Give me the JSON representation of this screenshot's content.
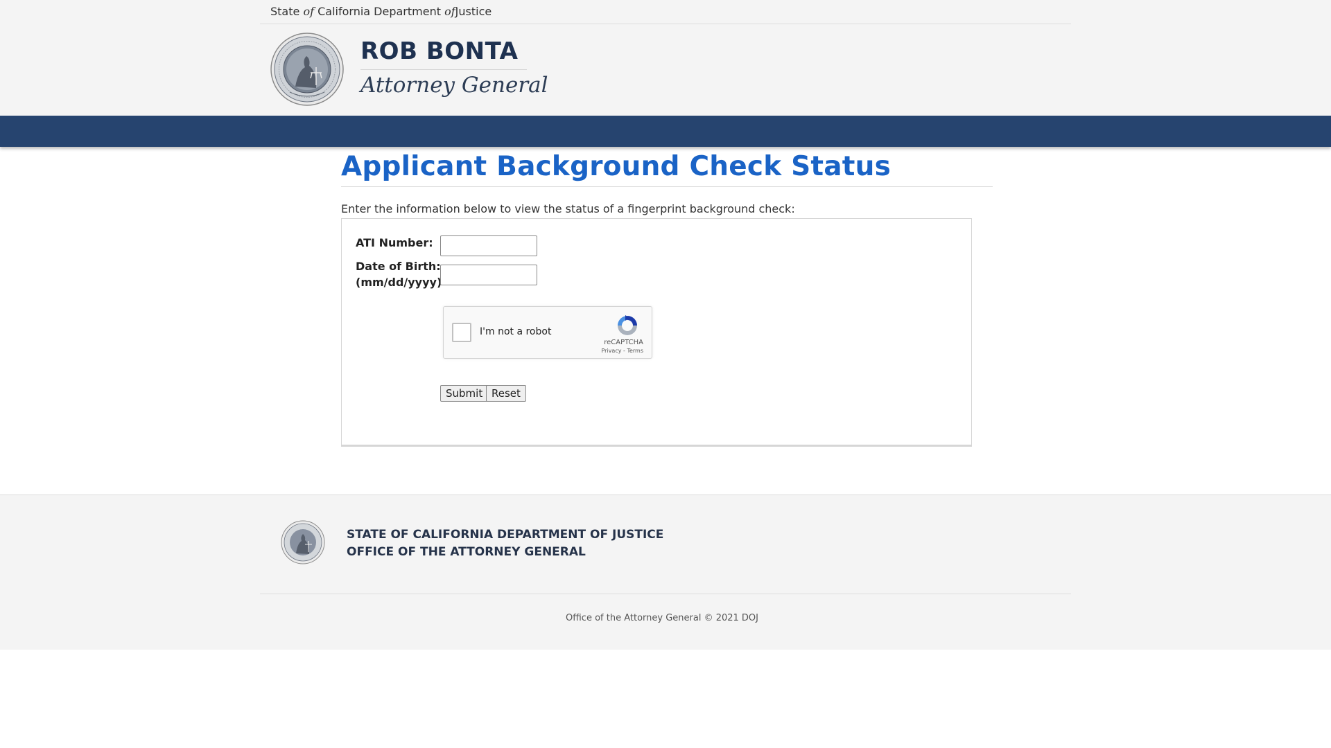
{
  "header": {
    "agency_prefix": "State",
    "agency_of1": "of",
    "agency_middle": "California Department",
    "agency_of2": "of",
    "agency_suffix": "Justice",
    "name": "ROB BONTA",
    "title": "Attorney General"
  },
  "main": {
    "page_title": "Applicant Background Check Status",
    "intro": "Enter the information below to view the status of a fingerprint background check:",
    "form": {
      "ati_label": "ATI Number:",
      "ati_value": "",
      "dob_label": "Date of Birth:",
      "dob_hint": "(mm/dd/yyyy)",
      "dob_value": "",
      "captcha": {
        "label": "I'm not a robot",
        "brand": "reCAPTCHA",
        "privacy": "Privacy",
        "separator": " - ",
        "terms": "Terms"
      },
      "submit_label": "Submit",
      "reset_label": "Reset"
    }
  },
  "footer": {
    "org_line1": "STATE OF CALIFORNIA DEPARTMENT OF JUSTICE",
    "org_line2": "OFFICE OF THE ATTORNEY GENERAL",
    "copyright": "Office of the Attorney General © 2021 DOJ"
  },
  "colors": {
    "nav_band": "#26446f",
    "title_blue": "#1a63c6",
    "dark_navy": "#1e3150"
  }
}
